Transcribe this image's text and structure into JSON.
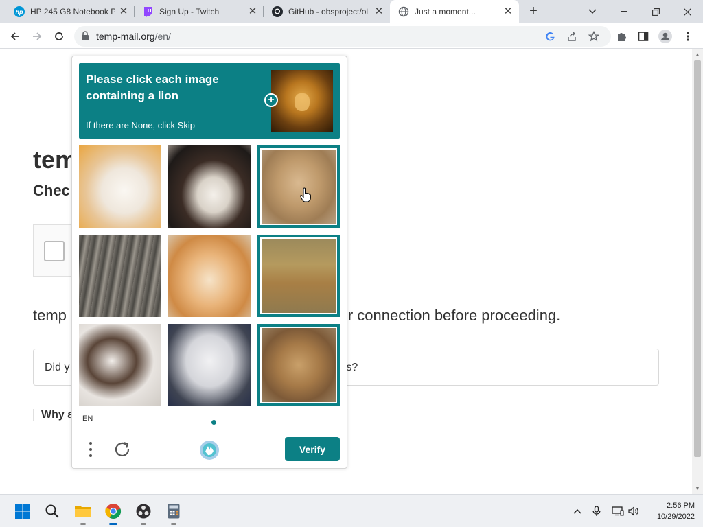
{
  "browser": {
    "tabs": [
      {
        "title": "HP 245 G8 Notebook P",
        "active": false
      },
      {
        "title": "Sign Up - Twitch",
        "active": false
      },
      {
        "title": "GitHub - obsproject/ol",
        "active": false
      },
      {
        "title": "Just a moment...",
        "active": true
      }
    ],
    "address": {
      "host": "temp-mail.org",
      "path": "/en/"
    }
  },
  "page": {
    "heading": "tem",
    "subheading": "Check",
    "text_left": "temp",
    "text_right": "of your connection before proceeding.",
    "details_left": "Did y",
    "details_right": "ites?",
    "why_text": "Why a"
  },
  "captcha": {
    "prompt_title": "Please click each image containing a lion",
    "prompt_sub": "If there are None, click Skip",
    "language": "EN",
    "verify_label": "Verify",
    "tiles": [
      {
        "subject": "dog",
        "selected": false
      },
      {
        "subject": "dog",
        "selected": false
      },
      {
        "subject": "lion",
        "selected": true
      },
      {
        "subject": "cat",
        "selected": false
      },
      {
        "subject": "cat",
        "selected": false
      },
      {
        "subject": "lion",
        "selected": true
      },
      {
        "subject": "dog",
        "selected": false
      },
      {
        "subject": "dog",
        "selected": false
      },
      {
        "subject": "lion",
        "selected": true
      }
    ]
  },
  "taskbar": {
    "time": "2:56 PM",
    "date": "10/29/2022"
  },
  "colors": {
    "captcha_accent": "#0c8085",
    "taskbar_running": "#0067c0"
  }
}
